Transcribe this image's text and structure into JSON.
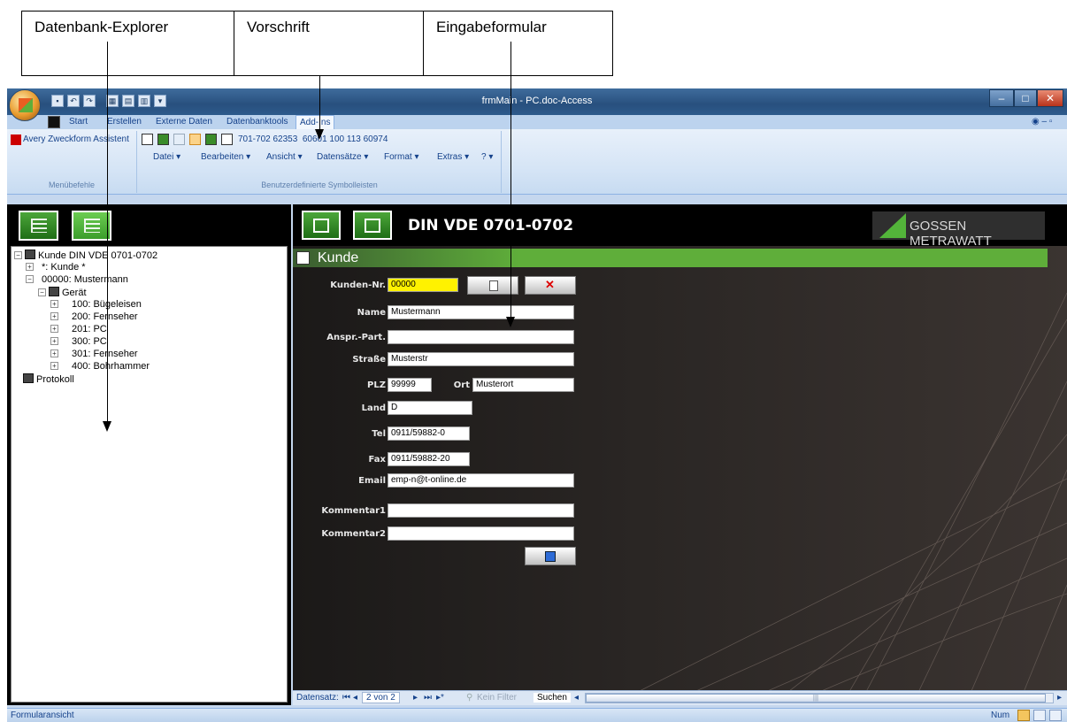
{
  "annotations": {
    "explorer": "Datenbank-Explorer",
    "vorschrift": "Vorschrift",
    "eingabe": "Eingabeformular"
  },
  "window": {
    "title": "frmMain - PC.doc-Access"
  },
  "ribbon": {
    "tabs": [
      "Start",
      "Erstellen",
      "Externe Daten",
      "Datenbanktools",
      "Add-Ins"
    ],
    "avery_button": "Avery Zweckform Assistent",
    "group_menu_label": "Menübefehle",
    "group_toolbar_label": "Benutzerdefinierte Symbolleisten",
    "vorschrift_text": "701-702 62353  60601 100 113 60974",
    "menus": [
      "Datei",
      "Bearbeiten",
      "Ansicht",
      "Datensätze",
      "Format",
      "Extras",
      "?"
    ]
  },
  "tree": {
    "root": "Kunde DIN VDE 0701-0702",
    "new_customer": "*: Kunde *",
    "customer": "00000: Mustermann",
    "device_group": "Gerät",
    "devices": [
      "100: Bügeleisen",
      "200: Fernseher",
      "201: PC",
      "300: PC",
      "301: Fernseher",
      "400: Bohrhammer"
    ],
    "protocol": "Protokoll"
  },
  "form": {
    "title": "DIN VDE 0701-0702",
    "section": "Kunde",
    "logo": "GOSSEN METRAWATT",
    "labels": {
      "kunden_nr": "Kunden-Nr.",
      "name": "Name",
      "anspr": "Anspr.-Part.",
      "strasse": "Straße",
      "plz": "PLZ",
      "ort": "Ort",
      "land": "Land",
      "tel": "Tel",
      "fax": "Fax",
      "email": "Email",
      "kommentar1": "Kommentar1",
      "kommentar2": "Kommentar2"
    },
    "values": {
      "kunden_nr": "00000",
      "name": "Mustermann",
      "anspr": "",
      "strasse": "Musterstr",
      "plz": "99999",
      "ort": "Musterort",
      "land": "D",
      "tel": "0911/59882-0",
      "fax": "0911/59882-20",
      "email": "emp-n@t-online.de",
      "kommentar1": "",
      "kommentar2": ""
    }
  },
  "navigation": {
    "label": "Datensatz:",
    "position": "2 von 2",
    "filter": "Kein Filter",
    "search": "Suchen"
  },
  "status": {
    "left": "Formularansicht",
    "right": "Num"
  },
  "colors": {
    "accent_green": "#5fae3a",
    "kunden_nr_highlight": "#fff200"
  }
}
